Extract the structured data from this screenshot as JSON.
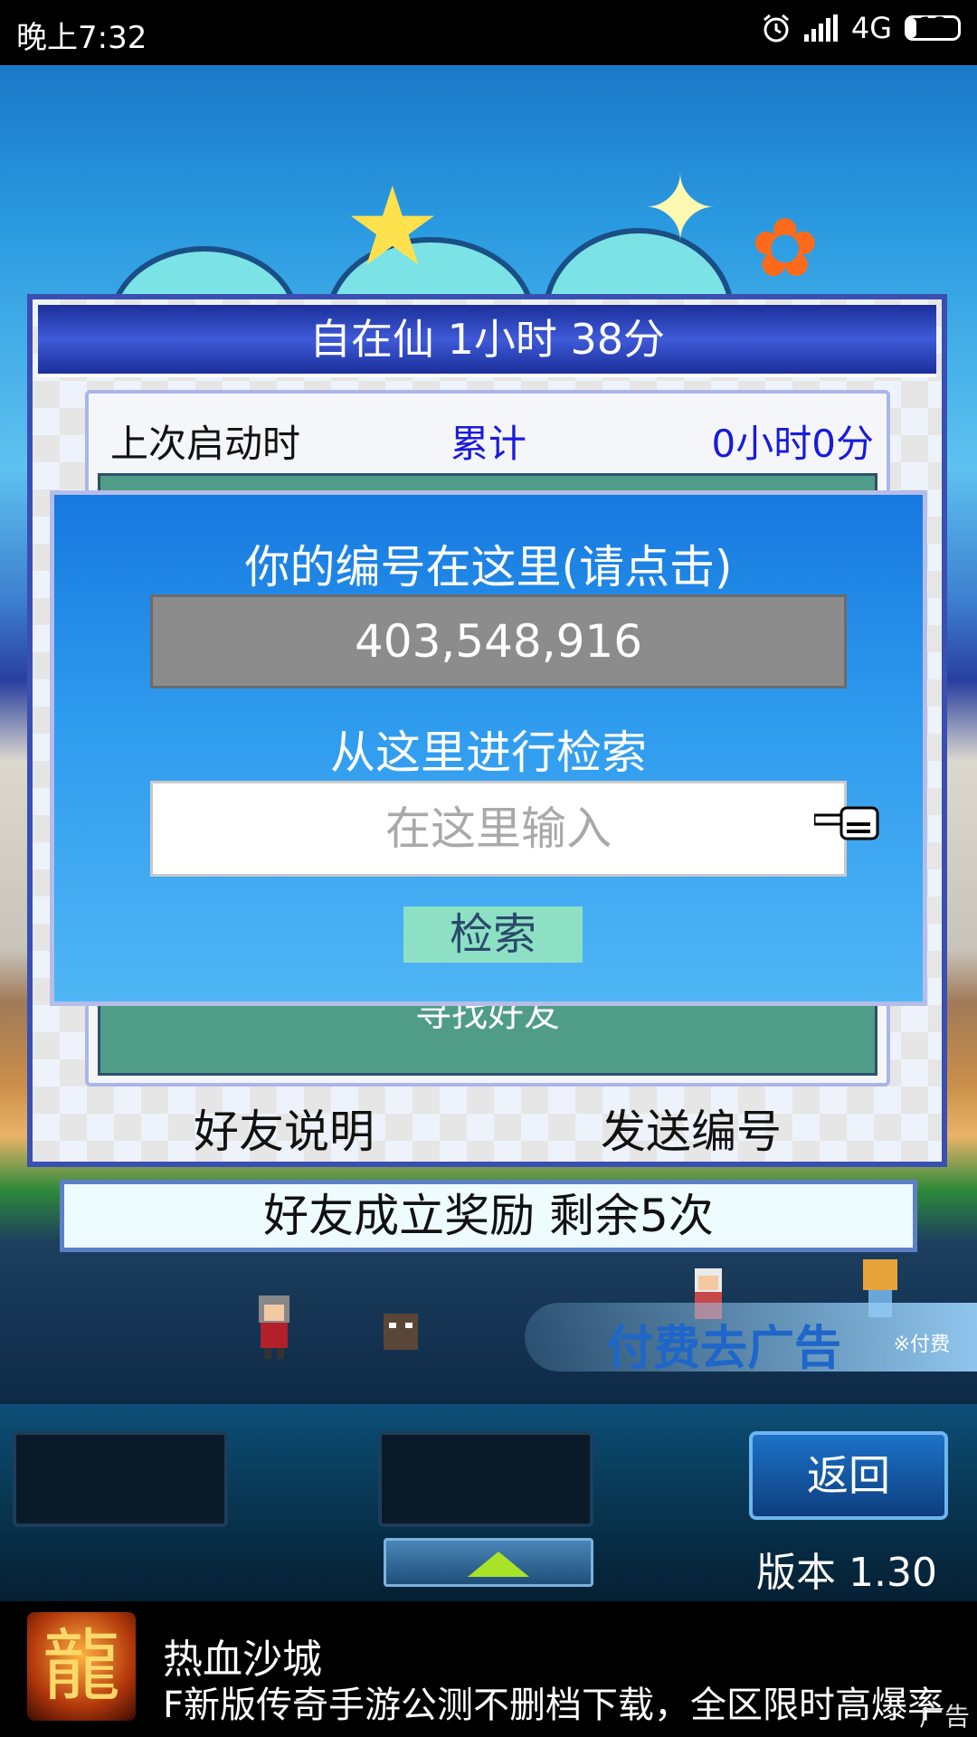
{
  "status_bar": {
    "time": "晚上7:32",
    "network": "4G",
    "battery": "18",
    "battery_level": 0.18
  },
  "panel": {
    "title": "自在仙  1小时 38分",
    "info": {
      "label": "上次启动时",
      "middle": "累计",
      "value": "0小时0分"
    },
    "find_friend": "寻找好友",
    "friend_help": "好友说明",
    "send_id": "发送编号"
  },
  "dialog": {
    "id_label": "你的编号在这里(请点击)",
    "id_value": "403,548,916",
    "search_label": "从这里进行检索",
    "search_placeholder": "在这里输入",
    "search_button": "检索"
  },
  "reward": "好友成立奖励  剩余5次",
  "ad_removal": {
    "label": "付费去广告",
    "note": "※付费"
  },
  "controls": {
    "back": "返回",
    "version": "版本 1.30"
  },
  "ad": {
    "icon_char": "龍",
    "title": "热血沙城",
    "description": "F新版传奇手游公测不删档下载，全区限时高爆率",
    "tag": "广告"
  },
  "colors": {
    "panel_title": "#2b44c0",
    "dialog": "#2f9bee",
    "link_blue": "#1a1adc",
    "search_button": "#8ee0c5"
  }
}
